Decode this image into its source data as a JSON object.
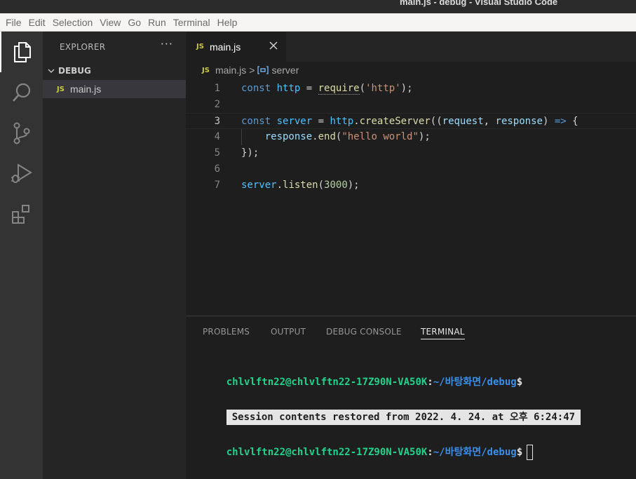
{
  "window": {
    "title": "main.js - debug - Visual Studio Code"
  },
  "menu": [
    "File",
    "Edit",
    "Selection",
    "View",
    "Go",
    "Run",
    "Terminal",
    "Help"
  ],
  "activity_bar": [
    "explorer-icon",
    "search-icon",
    "source-control-icon",
    "run-debug-icon",
    "extensions-icon"
  ],
  "sidebar": {
    "title": "EXPLORER",
    "more": "···",
    "section": "DEBUG",
    "files": [
      {
        "badge": "JS",
        "name": "main.js"
      }
    ]
  },
  "tab": {
    "badge": "JS",
    "label": "main.js"
  },
  "breadcrumb": {
    "badge": "JS",
    "file": "main.js",
    "sep": ">",
    "symbol": "server"
  },
  "editor": {
    "lines": [
      {
        "n": "1",
        "tokens": [
          [
            "kw",
            "const"
          ],
          [
            "plain",
            " "
          ],
          [
            "var",
            "http"
          ],
          [
            "plain",
            " = "
          ],
          [
            "fn",
            "require"
          ],
          [
            "plain",
            "("
          ],
          [
            "str",
            "'http'"
          ],
          [
            "plain",
            ");"
          ]
        ]
      },
      {
        "n": "2",
        "tokens": []
      },
      {
        "n": "3",
        "tokens": [
          [
            "kw",
            "const"
          ],
          [
            "plain",
            " "
          ],
          [
            "var",
            "server"
          ],
          [
            "plain",
            " = "
          ],
          [
            "var",
            "http"
          ],
          [
            "plain",
            "."
          ],
          [
            "fn",
            "createServer"
          ],
          [
            "plain",
            "(("
          ],
          [
            "param",
            "request"
          ],
          [
            "plain",
            ", "
          ],
          [
            "param",
            "response"
          ],
          [
            "plain",
            ") "
          ],
          [
            "kw",
            "=>"
          ],
          [
            "plain",
            " {"
          ]
        ]
      },
      {
        "n": "4",
        "tokens": [
          [
            "plain",
            "    "
          ],
          [
            "param",
            "response"
          ],
          [
            "plain",
            "."
          ],
          [
            "fn",
            "end"
          ],
          [
            "plain",
            "("
          ],
          [
            "str",
            "\"hello world\""
          ],
          [
            "plain",
            ");"
          ]
        ]
      },
      {
        "n": "5",
        "tokens": [
          [
            "plain",
            "});"
          ]
        ]
      },
      {
        "n": "6",
        "tokens": []
      },
      {
        "n": "7",
        "tokens": [
          [
            "var",
            "server"
          ],
          [
            "plain",
            "."
          ],
          [
            "fn",
            "listen"
          ],
          [
            "plain",
            "("
          ],
          [
            "num",
            "3000"
          ],
          [
            "plain",
            ");"
          ]
        ]
      }
    ]
  },
  "panel": {
    "tabs": [
      "PROBLEMS",
      "OUTPUT",
      "DEBUG CONSOLE",
      "TERMINAL"
    ],
    "active_tab": "TERMINAL",
    "terminal": {
      "prompt_user": "chlvlftn22@chlvlftn22-17Z90N-VA50K",
      "prompt_colon": ":",
      "prompt_path": "~/바탕화면/debug",
      "prompt_dollar": "$",
      "restore_msg": "Session contents restored from 2022. 4. 24. at 오후 6:24:47"
    }
  },
  "colors": {
    "accent": "#007acc",
    "js_badge": "#cbcb41",
    "terminal_user": "#23d18b",
    "terminal_path": "#3b8eea"
  }
}
